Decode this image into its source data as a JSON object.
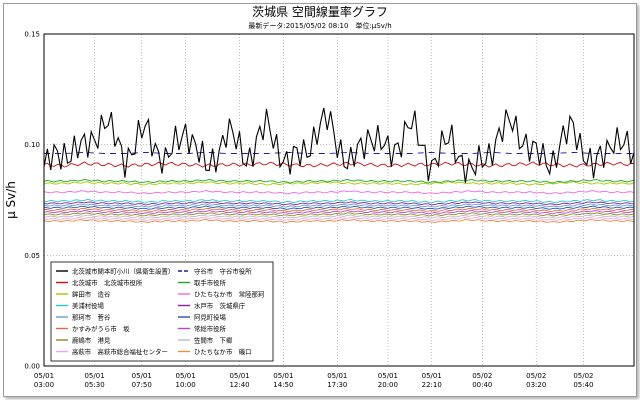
{
  "chart_data": {
    "type": "line",
    "title": "茨城県 空間線量率グラフ",
    "subtitle": "最新データ:2015/05/02 08:10　単位:μSv/h",
    "ylabel": "μ Sv/h",
    "xlabel": "",
    "ylim": [
      0.0,
      0.15
    ],
    "yticks": [
      "0.00",
      "0.05",
      "0.10",
      "0.15"
    ],
    "xlim": [
      0,
      29.167
    ],
    "xticks": [
      {
        "x": 0,
        "line1": "05/01",
        "line2": "03:00"
      },
      {
        "x": 2.5,
        "line1": "05/01",
        "line2": "05:30"
      },
      {
        "x": 4.833,
        "line1": "05/01",
        "line2": "07:50"
      },
      {
        "x": 7.0,
        "line1": "05/01",
        "line2": "10:00"
      },
      {
        "x": 9.667,
        "line1": "05/01",
        "line2": "12:40"
      },
      {
        "x": 11.833,
        "line1": "05/01",
        "line2": "14:50"
      },
      {
        "x": 14.5,
        "line1": "05/01",
        "line2": "17:30"
      },
      {
        "x": 17.0,
        "line1": "05/01",
        "line2": "20:00"
      },
      {
        "x": 19.167,
        "line1": "05/01",
        "line2": "22:10"
      },
      {
        "x": 21.667,
        "line1": "05/02",
        "line2": "00:40"
      },
      {
        "x": 24.333,
        "line1": "05/02",
        "line2": "03:20"
      },
      {
        "x": 26.667,
        "line1": "05/02",
        "line2": "05:40"
      }
    ],
    "grid": true,
    "legend_position": "bottom-left, inside plot",
    "series": [
      {
        "name": "北茨城市関本町小川（県衛生設置）",
        "color": "#000000",
        "style": "solid",
        "base": 0.1,
        "amp": 0.0075,
        "values": [
          0.09,
          0.097,
          0.098,
          0.111,
          0.094,
          0.107,
          0.092,
          0.108,
          0.088,
          0.106,
          0.094,
          0.109,
          0.09,
          0.1,
          0.112,
          0.089,
          0.106,
          0.095,
          0.11,
          0.091,
          0.103,
          0.086,
          0.099,
          0.111,
          0.096,
          0.093,
          0.109,
          0.088,
          0.104,
          0.094
        ]
      },
      {
        "name": "守谷市　守谷市役所",
        "color": "#1a1aa0",
        "style": "dashed",
        "base": 0.096,
        "amp": 0.0008,
        "values": [
          0.096,
          0.096,
          0.0965,
          0.096,
          0.096,
          0.0965,
          0.096,
          0.096,
          0.0965,
          0.096,
          0.096,
          0.096,
          0.0965,
          0.096,
          0.096,
          0.0965,
          0.096,
          0.096,
          0.096,
          0.0965,
          0.096,
          0.096,
          0.0965,
          0.096,
          0.096,
          0.096,
          0.0965,
          0.096,
          0.096,
          0.096
        ]
      },
      {
        "name": "北茨城市　北茨城市役所",
        "color": "#cc1111",
        "style": "solid",
        "base": 0.091,
        "amp": 0.0012,
        "values": [
          0.091,
          0.0905,
          0.0915,
          0.091,
          0.0905,
          0.091,
          0.0915,
          0.091,
          0.0905,
          0.091,
          0.091,
          0.0915,
          0.091,
          0.0905,
          0.091,
          0.0915,
          0.091,
          0.0905,
          0.091,
          0.091,
          0.0915,
          0.091,
          0.0905,
          0.091,
          0.0915,
          0.091,
          0.0905,
          0.091,
          0.0915,
          0.091
        ]
      },
      {
        "name": "取手市役所",
        "color": "#22aa22",
        "style": "solid",
        "base": 0.0835,
        "amp": 0.0006,
        "values": [
          0.0835,
          0.0835,
          0.084,
          0.0835,
          0.0835,
          0.083,
          0.0835,
          0.0835,
          0.084,
          0.0835,
          0.0835,
          0.0835,
          0.083,
          0.0835,
          0.0835,
          0.084,
          0.0835,
          0.0835,
          0.0835,
          0.083,
          0.0835,
          0.084,
          0.0835,
          0.0835,
          0.0835,
          0.083,
          0.0835,
          0.084,
          0.0835,
          0.0835
        ]
      },
      {
        "name": "鉾田市　造谷",
        "color": "#a8c800",
        "style": "solid",
        "base": 0.0825,
        "amp": 0.0006,
        "values": [
          0.0825,
          0.0825,
          0.083,
          0.0825,
          0.0825,
          0.082,
          0.0825,
          0.0825,
          0.083,
          0.0825,
          0.0825,
          0.082,
          0.0825,
          0.0825,
          0.083,
          0.0825,
          0.0825,
          0.0825,
          0.082,
          0.0825,
          0.083,
          0.0825,
          0.0825,
          0.0825,
          0.082,
          0.0825,
          0.083,
          0.0825,
          0.0825,
          0.0825
        ]
      },
      {
        "name": "ひたちなか市　常陸那珂",
        "color": "#ee66ee",
        "style": "solid",
        "base": 0.0785,
        "amp": 0.0005,
        "values": [
          0.0785,
          0.0785,
          0.079,
          0.0785,
          0.0785,
          0.078,
          0.0785,
          0.0785,
          0.079,
          0.0785,
          0.0785,
          0.0785,
          0.078,
          0.0785,
          0.0785,
          0.079,
          0.0785,
          0.0785,
          0.0785,
          0.078,
          0.0785,
          0.079,
          0.0785,
          0.0785,
          0.0785,
          0.078,
          0.0785,
          0.079,
          0.0785,
          0.0785
        ]
      },
      {
        "name": "美浦村役場",
        "color": "#22cccc",
        "style": "solid",
        "base": 0.0745,
        "amp": 0.0006,
        "values": [
          0.0745,
          0.0745,
          0.075,
          0.0745,
          0.0745,
          0.074,
          0.0745,
          0.0745,
          0.075,
          0.0745,
          0.0745,
          0.0745,
          0.074,
          0.0745,
          0.0745,
          0.075,
          0.0745,
          0.0745,
          0.0745,
          0.074,
          0.0745,
          0.075,
          0.0745,
          0.0745,
          0.0745,
          0.074,
          0.0745,
          0.075,
          0.0745,
          0.0745
        ]
      },
      {
        "name": "水戸市　茨城県庁",
        "color": "#882299",
        "style": "solid",
        "base": 0.0735,
        "amp": 0.0005,
        "values": [
          0.0735,
          0.0735,
          0.074,
          0.0735,
          0.0735,
          0.073,
          0.0735,
          0.0735,
          0.074,
          0.0735,
          0.0735,
          0.0735,
          0.073,
          0.0735,
          0.0735,
          0.074,
          0.0735,
          0.0735,
          0.0735,
          0.073,
          0.0735,
          0.074,
          0.0735,
          0.0735,
          0.0735,
          0.073,
          0.0735,
          0.074,
          0.0735,
          0.0735
        ]
      },
      {
        "name": "那珂市　菅谷",
        "color": "#6699dd",
        "style": "solid",
        "base": 0.0725,
        "amp": 0.0005,
        "values": [
          0.0725,
          0.0725,
          0.073,
          0.0725,
          0.0725,
          0.072,
          0.0725,
          0.0725,
          0.073,
          0.0725,
          0.0725,
          0.0725,
          0.072,
          0.0725,
          0.0725,
          0.073,
          0.0725,
          0.0725,
          0.0725,
          0.072,
          0.0725,
          0.073,
          0.0725,
          0.0725,
          0.0725,
          0.072,
          0.0725,
          0.073,
          0.0725,
          0.0725
        ]
      },
      {
        "name": "阿見町役場",
        "color": "#2255aa",
        "style": "solid",
        "base": 0.0715,
        "amp": 0.0005,
        "values": [
          0.0715,
          0.0715,
          0.072,
          0.0715,
          0.0715,
          0.071,
          0.0715,
          0.0715,
          0.072,
          0.0715,
          0.0715,
          0.0715,
          0.071,
          0.0715,
          0.0715,
          0.072,
          0.0715,
          0.0715,
          0.0715,
          0.071,
          0.0715,
          0.072,
          0.0715,
          0.0715,
          0.0715,
          0.071,
          0.0715,
          0.072,
          0.0715,
          0.0715
        ]
      },
      {
        "name": "かすみがうら市　坂",
        "color": "#e86a3a",
        "style": "solid",
        "base": 0.0705,
        "amp": 0.0005,
        "values": [
          0.0705,
          0.0705,
          0.071,
          0.0705,
          0.0705,
          0.07,
          0.0705,
          0.0705,
          0.071,
          0.0705,
          0.0705,
          0.0705,
          0.07,
          0.0705,
          0.0705,
          0.071,
          0.0705,
          0.0705,
          0.0705,
          0.07,
          0.0705,
          0.071,
          0.0705,
          0.0705,
          0.0705,
          0.07,
          0.0705,
          0.071,
          0.0705,
          0.0705
        ]
      },
      {
        "name": "常総市役所",
        "color": "#bb44cc",
        "style": "solid",
        "base": 0.0695,
        "amp": 0.0005,
        "values": [
          0.0695,
          0.0695,
          0.07,
          0.0695,
          0.0695,
          0.069,
          0.0695,
          0.0695,
          0.07,
          0.0695,
          0.0695,
          0.0695,
          0.069,
          0.0695,
          0.0695,
          0.07,
          0.0695,
          0.0695,
          0.0695,
          0.069,
          0.0695,
          0.07,
          0.0695,
          0.0695,
          0.0695,
          0.069,
          0.0695,
          0.07,
          0.0695,
          0.0695
        ]
      },
      {
        "name": "鹿嶋市　港見",
        "color": "#8a8a22",
        "style": "solid",
        "base": 0.0685,
        "amp": 0.0005,
        "values": [
          0.0685,
          0.0685,
          0.069,
          0.0685,
          0.0685,
          0.068,
          0.0685,
          0.0685,
          0.069,
          0.0685,
          0.0685,
          0.0685,
          0.068,
          0.0685,
          0.0685,
          0.069,
          0.0685,
          0.0685,
          0.0685,
          0.068,
          0.0685,
          0.069,
          0.0685,
          0.0685,
          0.0685,
          0.068,
          0.0685,
          0.069,
          0.0685,
          0.0685
        ]
      },
      {
        "name": "笠間市　下郷",
        "color": "#bbbbbb",
        "style": "solid",
        "base": 0.0675,
        "amp": 0.0005,
        "values": [
          0.0675,
          0.0675,
          0.068,
          0.0675,
          0.0675,
          0.067,
          0.0675,
          0.0675,
          0.068,
          0.0675,
          0.0675,
          0.0675,
          0.067,
          0.0675,
          0.0675,
          0.068,
          0.0675,
          0.0675,
          0.0675,
          0.067,
          0.0675,
          0.068,
          0.0675,
          0.0675,
          0.0675,
          0.067,
          0.0675,
          0.068,
          0.0675,
          0.0675
        ]
      },
      {
        "name": "高萩市　高萩市総合福祉センター",
        "color": "#f2a6e6",
        "style": "solid",
        "base": 0.0665,
        "amp": 0.0005,
        "values": [
          0.0665,
          0.0665,
          0.067,
          0.0665,
          0.0665,
          0.066,
          0.0665,
          0.0665,
          0.067,
          0.0665,
          0.0665,
          0.0665,
          0.066,
          0.0665,
          0.0665,
          0.067,
          0.0665,
          0.0665,
          0.0665,
          0.066,
          0.0665,
          0.067,
          0.0665,
          0.0665,
          0.0665,
          0.066,
          0.0665,
          0.067,
          0.0665,
          0.0665
        ]
      },
      {
        "name": "ひたちなか市　磯口",
        "color": "#f08844",
        "style": "solid",
        "base": 0.0655,
        "amp": 0.0005,
        "values": [
          0.0655,
          0.0655,
          0.066,
          0.0655,
          0.0655,
          0.065,
          0.0655,
          0.0655,
          0.066,
          0.0655,
          0.0655,
          0.0655,
          0.065,
          0.0655,
          0.0655,
          0.066,
          0.0655,
          0.0655,
          0.0655,
          0.065,
          0.0655,
          0.066,
          0.0655,
          0.0655,
          0.0655,
          0.065,
          0.0655,
          0.066,
          0.0655,
          0.0655
        ]
      }
    ]
  }
}
